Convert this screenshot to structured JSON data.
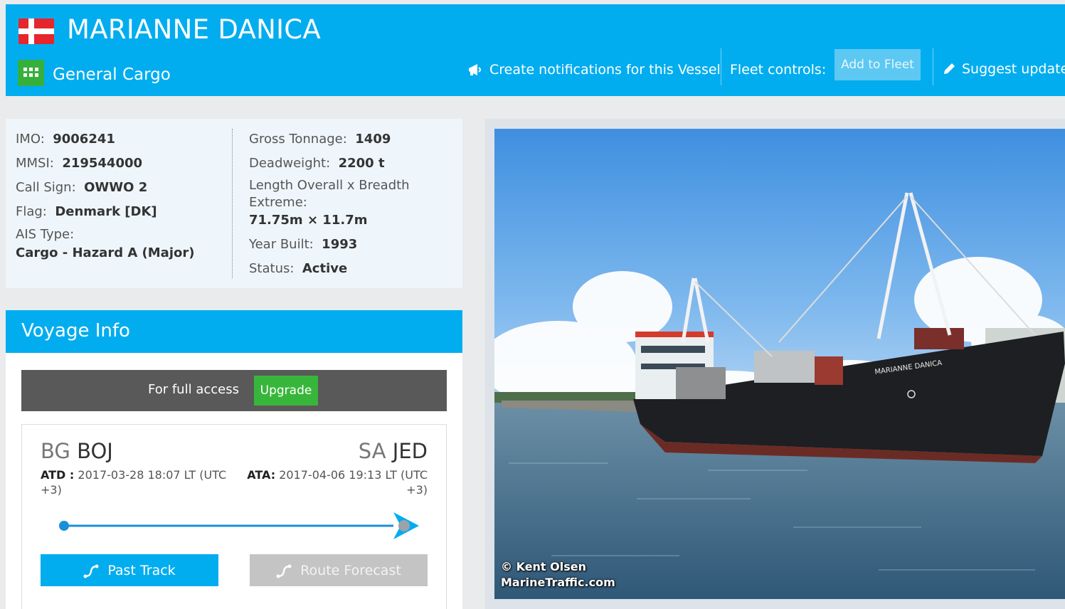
{
  "header": {
    "vessel_name": "MARIANNE DANICA",
    "vessel_type": "General Cargo",
    "notifications_label": "Create notifications for this Vessel",
    "fleet_controls_label": "Fleet controls:",
    "add_to_fleet_label": "Add to Fleet",
    "suggest_updates_label": "Suggest updates",
    "flag_icon": "denmark-flag-icon",
    "type_icon": "general-cargo-grid-icon",
    "colors": {
      "header_bg": "#01adef",
      "type_badge": "#36b03c",
      "flag_red": "#e5262c"
    }
  },
  "details": {
    "imo": {
      "label": "IMO:",
      "value": "9006241"
    },
    "mmsi": {
      "label": "MMSI:",
      "value": "219544000"
    },
    "call_sign": {
      "label": "Call Sign:",
      "value": "OWWO 2"
    },
    "flag": {
      "label": "Flag:",
      "value": "Denmark [DK]"
    },
    "ais_type": {
      "label": "AIS Type:",
      "value": "Cargo - Hazard A (Major)"
    },
    "gross_tonnage": {
      "label": "Gross Tonnage:",
      "value": "1409"
    },
    "deadweight": {
      "label": "Deadweight:",
      "value": "2200 t"
    },
    "length_breadth": {
      "label": "Length Overall x Breadth Extreme:",
      "value": "71.75m × 11.7m"
    },
    "year_built": {
      "label": "Year Built:",
      "value": "1993"
    },
    "status": {
      "label": "Status:",
      "value": "Active"
    }
  },
  "voyage": {
    "title": "Voyage Info",
    "full_access_text": "For full access",
    "upgrade_label": "Upgrade",
    "departure": {
      "country": "BG",
      "port": "BOJ",
      "time_label": "ATD :",
      "time_value": " 2017-03-28 18:07 LT  (UTC +3)"
    },
    "arrival": {
      "country": "SA",
      "port": "JED",
      "time_label": "ATA:",
      "time_value": " 2017-04-06 19:13 LT  (UTC +3)"
    },
    "progress": 1.0,
    "past_track_label": "Past Track",
    "route_forecast_label": "Route Forecast",
    "colors": {
      "track": "#1a8fd8",
      "upgrade_green": "#38b63b"
    }
  },
  "photo": {
    "credit_line1": "© Kent Olsen",
    "credit_line2": "MarineTraffic.com",
    "ship_hull_text": "MARIANNE DANICA"
  }
}
